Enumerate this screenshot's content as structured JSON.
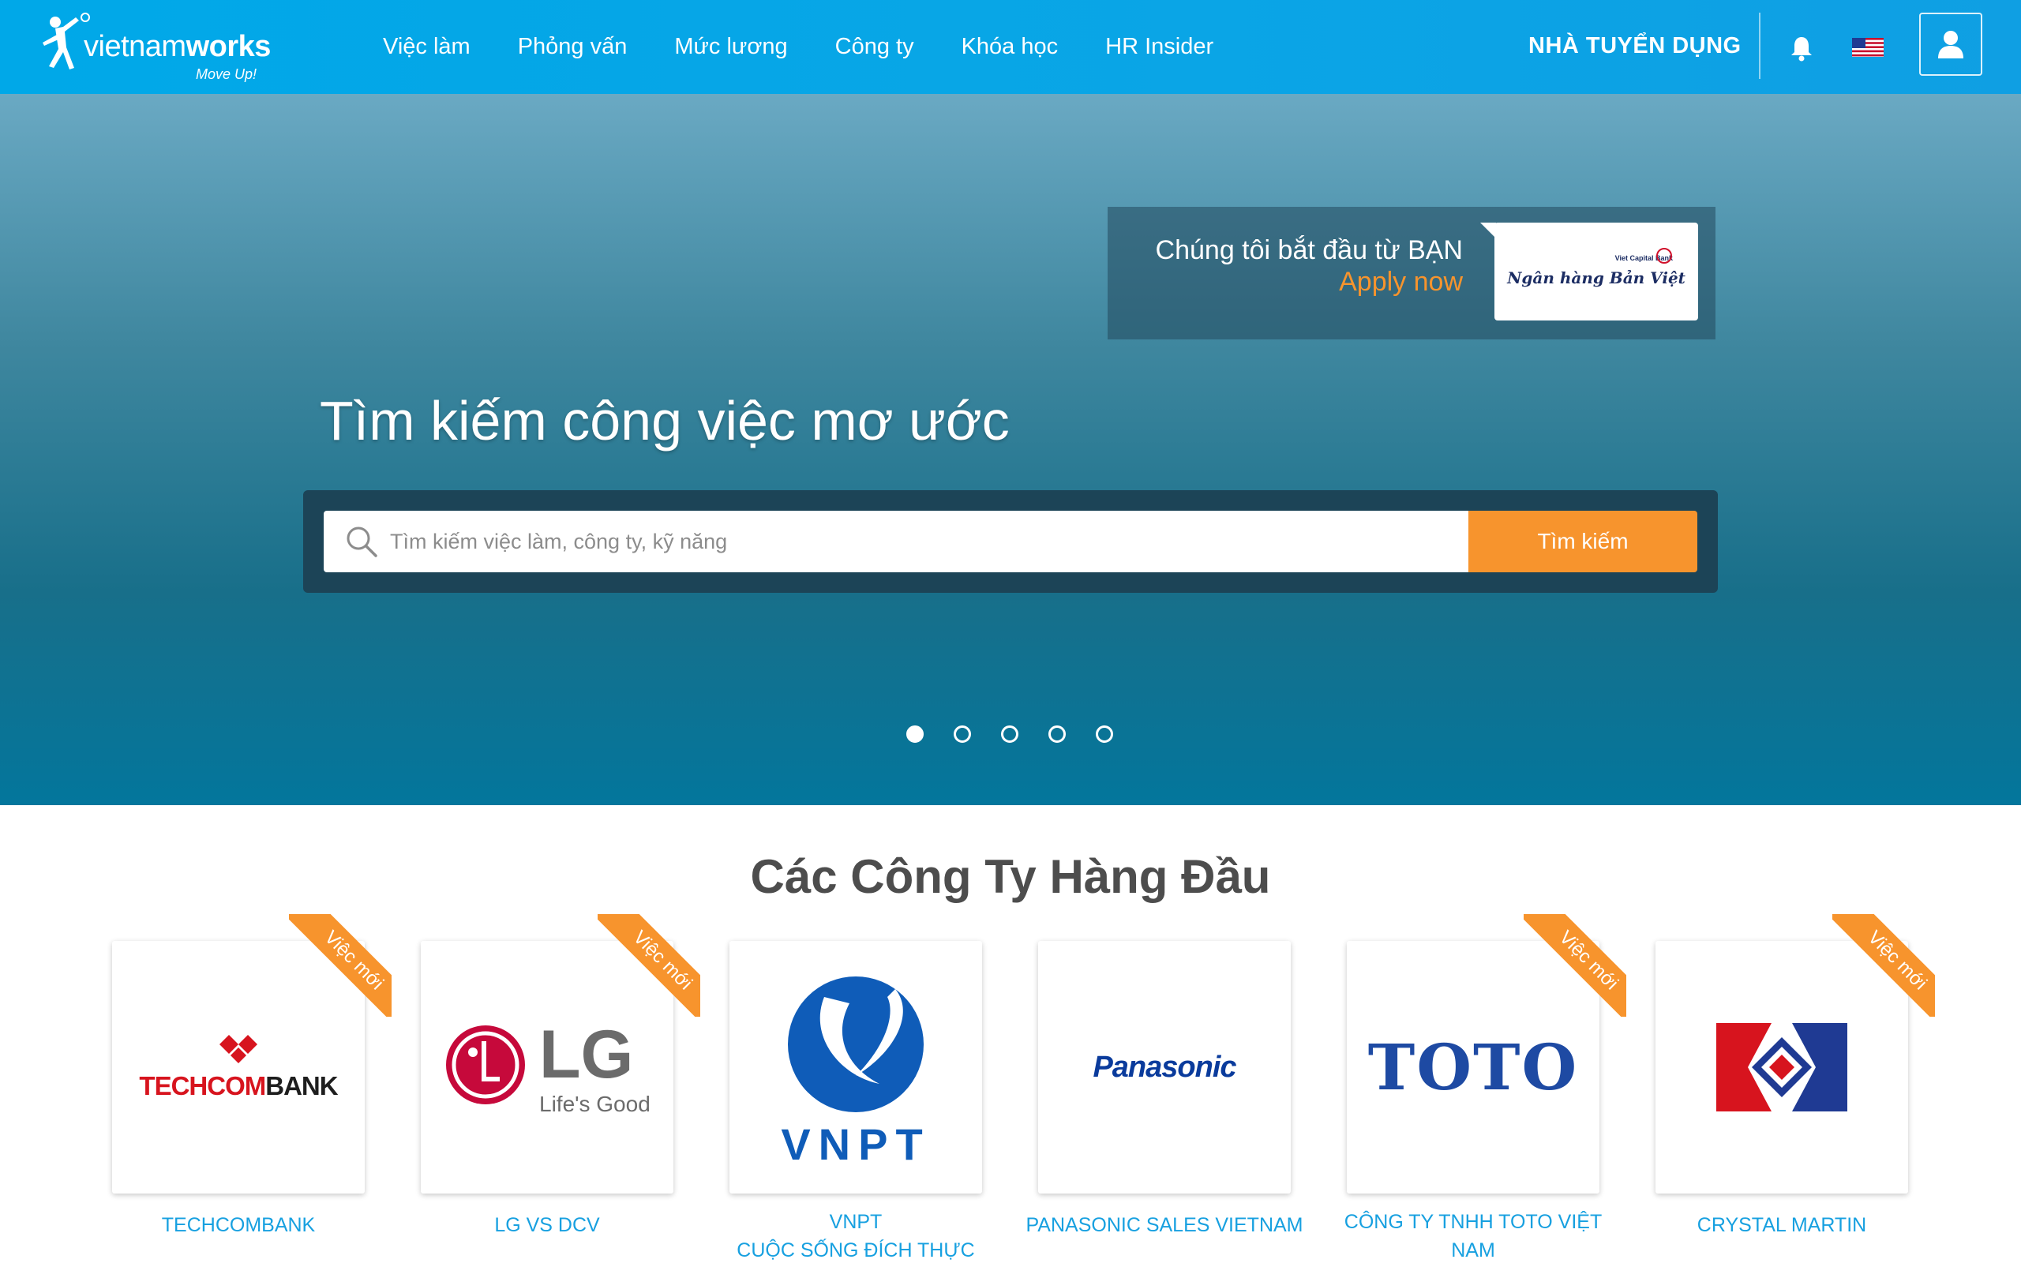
{
  "brand": {
    "name_light": "vietnam",
    "name_bold": "works",
    "tagline": "Move Up!"
  },
  "nav": {
    "items": [
      {
        "label": "Việc làm"
      },
      {
        "label": "Phỏng vấn"
      },
      {
        "label": "Mức lương"
      },
      {
        "label": "Công ty"
      },
      {
        "label": "Khóa học"
      },
      {
        "label": "HR Insider"
      }
    ],
    "employer_label": "NHÀ TUYỂN DỤNG",
    "language_icon": "us-flag-icon",
    "notification_icon": "bell-icon",
    "account_icon": "user-icon"
  },
  "promo": {
    "line1": "Chúng tôi bắt đầu từ BẠN",
    "line2": "Apply now",
    "logo_small": "Viet Capital Bank",
    "logo_name": "Ngân hàng Bản Việt"
  },
  "hero": {
    "title": "Tìm kiếm công việc mơ ước",
    "search_placeholder": "Tìm kiếm việc làm, công ty, kỹ năng",
    "search_button": "Tìm kiếm",
    "slides_total": 5,
    "active_slide": 1
  },
  "companies": {
    "title": "Các Công Ty Hàng Đầu",
    "ribbon_label": "Việc mới",
    "items": [
      {
        "name": "TECHCOMBANK",
        "logo_red": "TECHCOM",
        "logo_dark": "BANK",
        "new_jobs": true
      },
      {
        "name": "LG VS DCV",
        "logo_text": "LG",
        "logo_tagline": "Life's Good",
        "new_jobs": true
      },
      {
        "name_line1": "VNPT",
        "name_line2": "CUỘC SỐNG ĐÍCH THỰC",
        "logo_text": "VNPT",
        "new_jobs": false
      },
      {
        "name": "PANASONIC SALES VIETNAM",
        "logo_text": "Panasonic",
        "new_jobs": false
      },
      {
        "name_line1": "CÔNG TY TNHH TOTO VIỆT",
        "name_line2": "NAM",
        "logo_text": "TOTO",
        "new_jobs": true
      },
      {
        "name": "CRYSTAL MARTIN",
        "new_jobs": true
      }
    ]
  },
  "colors": {
    "header": "#00a8e8",
    "accent_orange": "#f7942d",
    "link_blue": "#17a0e0"
  }
}
